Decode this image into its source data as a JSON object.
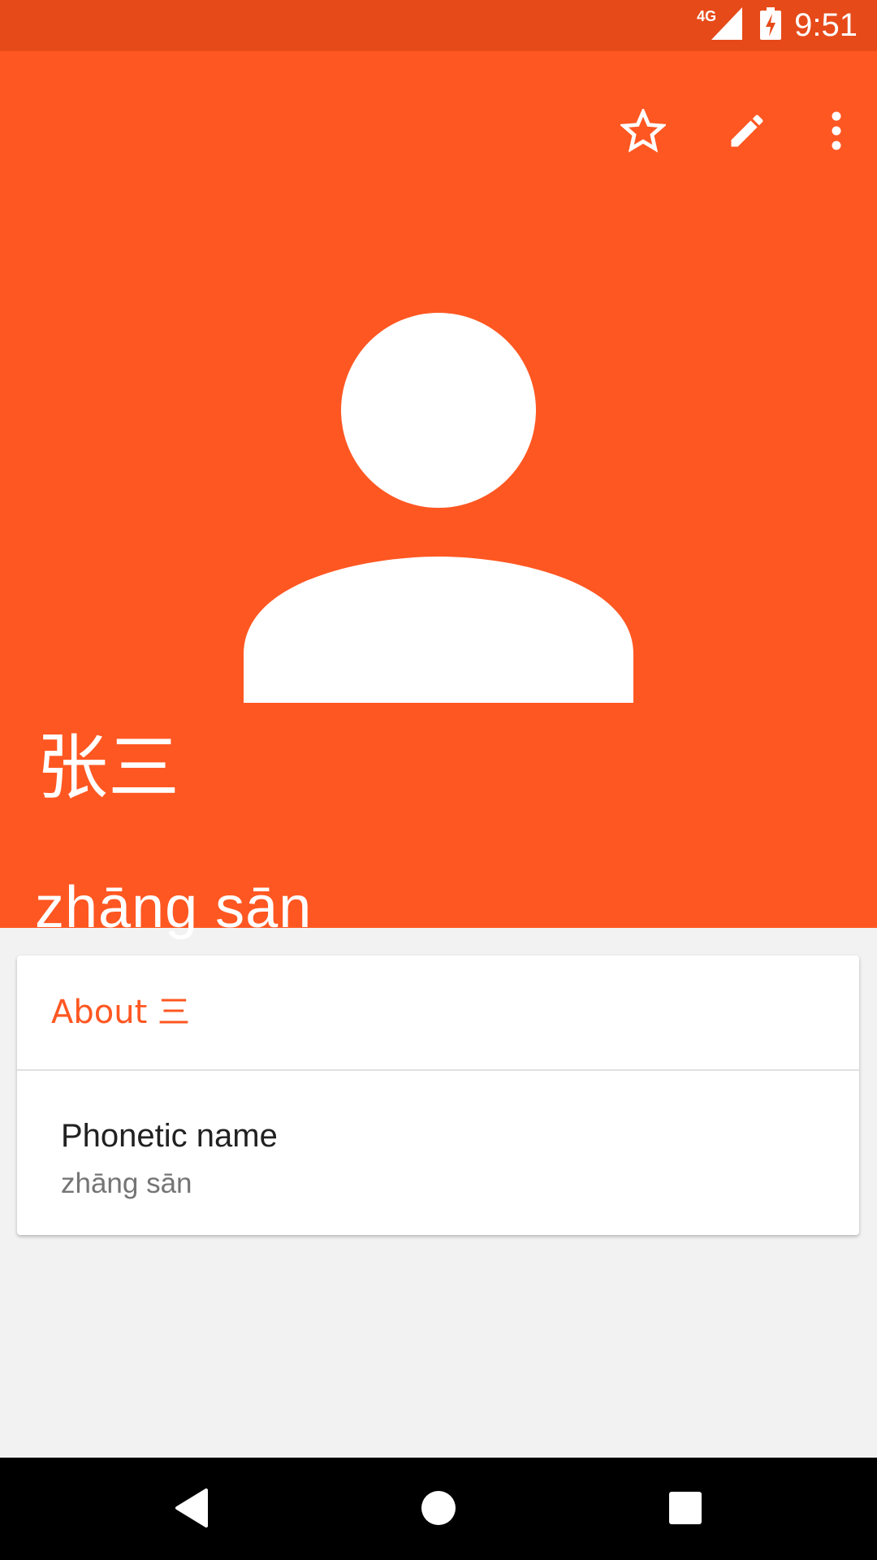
{
  "status_bar": {
    "network": "4G",
    "time": "9:51"
  },
  "header": {
    "background": "#ff5722",
    "actions": [
      {
        "name": "star-icon"
      },
      {
        "name": "edit-icon"
      },
      {
        "name": "more-vert-icon"
      }
    ],
    "avatar_icon": "person-icon",
    "name": "张三",
    "phonetic": "zhāng sān"
  },
  "about_card": {
    "title": "About 三",
    "field_label": "Phonetic name",
    "field_value": "zhāng sān"
  },
  "nav": {
    "back_icon": "back-icon",
    "home_icon": "home-icon",
    "recents_icon": "recents-icon"
  },
  "colors": {
    "accent": "#ff5722",
    "status_bar": "#e64a19"
  }
}
